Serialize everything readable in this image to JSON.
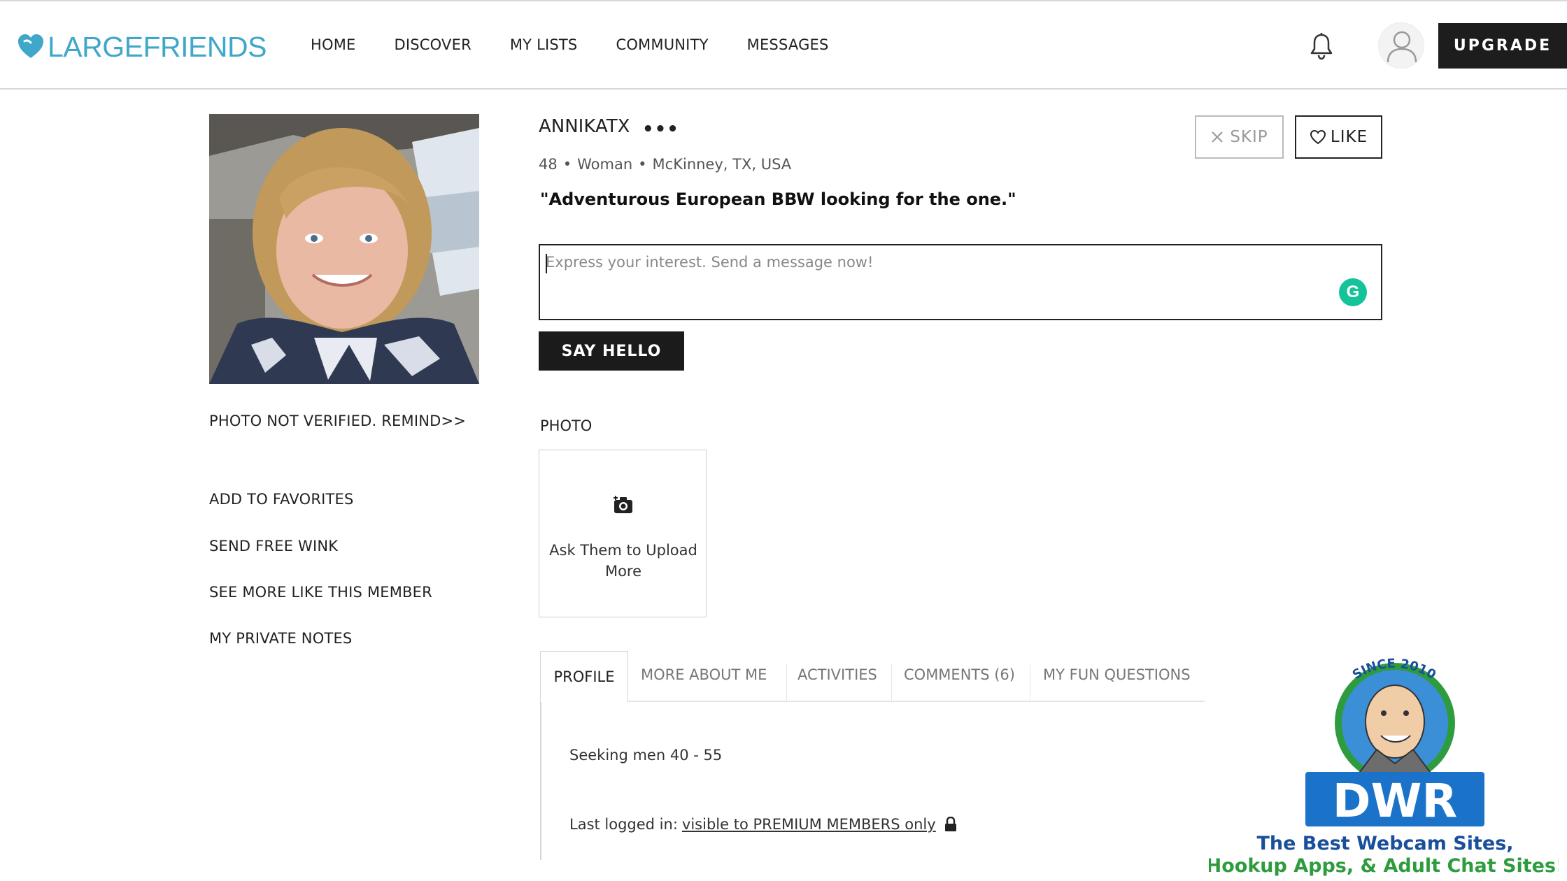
{
  "brand": {
    "name": "LARGEFRIENDS",
    "color": "#3fa7c9"
  },
  "nav": {
    "items": [
      "HOME",
      "DISCOVER",
      "MY LISTS",
      "COMMUNITY",
      "MESSAGES"
    ],
    "upgrade_label": "UPGRADE"
  },
  "profile": {
    "username": "ANNIKATX",
    "more_label": "•••",
    "age": "48",
    "gender": "Woman",
    "location": "McKinney, TX, USA",
    "separator": "•",
    "headline": "\"Adventurous European BBW looking for the one.\""
  },
  "actions": {
    "skip_label": "SKIP",
    "like_label": "LIKE"
  },
  "message": {
    "placeholder": "Express your interest. Send a message now!",
    "send_label": "SAY HELLO"
  },
  "left_links": {
    "verify": "PHOTO NOT VERIFIED. REMIND>>",
    "favorites": "ADD TO FAVORITES",
    "wink": "SEND FREE WINK",
    "similar": "SEE MORE LIKE THIS MEMBER",
    "notes": "MY PRIVATE NOTES"
  },
  "photos": {
    "heading": "PHOTO",
    "upload_label": "Ask Them to Upload More"
  },
  "tabs": [
    "PROFILE",
    "MORE ABOUT ME",
    "ACTIVITIES",
    "COMMENTS (6)",
    "MY FUN QUESTIONS"
  ],
  "profile_tab": {
    "seeking": "Seeking men 40 - 55",
    "last_logged_label": "Last logged in:",
    "last_logged_value": "visible to PREMIUM MEMBERS only"
  },
  "watermark": {
    "since": "SINCE 2010",
    "logo": "DWR",
    "tagline_1": "The Best Webcam Sites,",
    "tagline_2": "Hookup Apps, & Adult Chat Sites!",
    "colors": {
      "blue": "#1a73c9",
      "green": "#2e9c3e",
      "dark_blue": "#1a4f9c"
    }
  }
}
